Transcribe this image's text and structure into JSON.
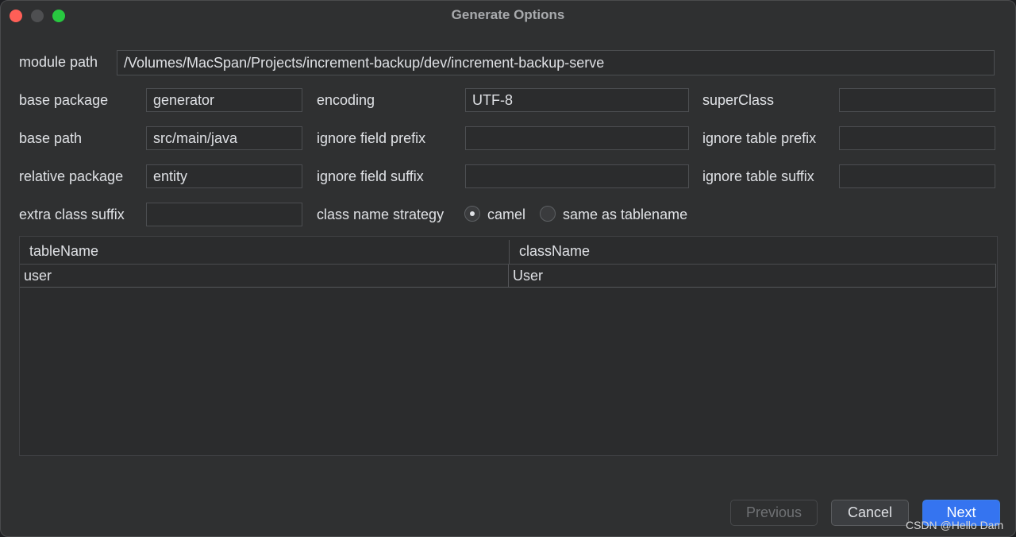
{
  "window": {
    "title": "Generate Options"
  },
  "form": {
    "module_path": {
      "label": "module path",
      "value": "/Volumes/MacSpan/Projects/increment-backup/dev/increment-backup-serve"
    },
    "base_package": {
      "label": "base package",
      "value": "generator"
    },
    "encoding": {
      "label": "encoding",
      "value": "UTF-8"
    },
    "super_class": {
      "label": "superClass",
      "value": ""
    },
    "base_path": {
      "label": "base path",
      "value": "src/main/java"
    },
    "ignore_field_prefix": {
      "label": "ignore field prefix",
      "value": ""
    },
    "ignore_table_prefix": {
      "label": "ignore table prefix",
      "value": ""
    },
    "relative_package": {
      "label": "relative package",
      "value": "entity"
    },
    "ignore_field_suffix": {
      "label": "ignore field suffix",
      "value": ""
    },
    "ignore_table_suffix": {
      "label": "ignore table suffix",
      "value": ""
    },
    "extra_class_suffix": {
      "label": "extra class suffix",
      "value": ""
    },
    "class_name_strategy": {
      "label": "class name strategy",
      "options": [
        {
          "label": "camel",
          "selected": true
        },
        {
          "label": "same as tablename",
          "selected": false
        }
      ]
    }
  },
  "table": {
    "columns": [
      "tableName",
      "className"
    ],
    "rows": [
      [
        "user",
        "User"
      ]
    ]
  },
  "buttons": {
    "previous": "Previous",
    "cancel": "Cancel",
    "next": "Next"
  },
  "watermark": "CSDN @Hello Dam"
}
